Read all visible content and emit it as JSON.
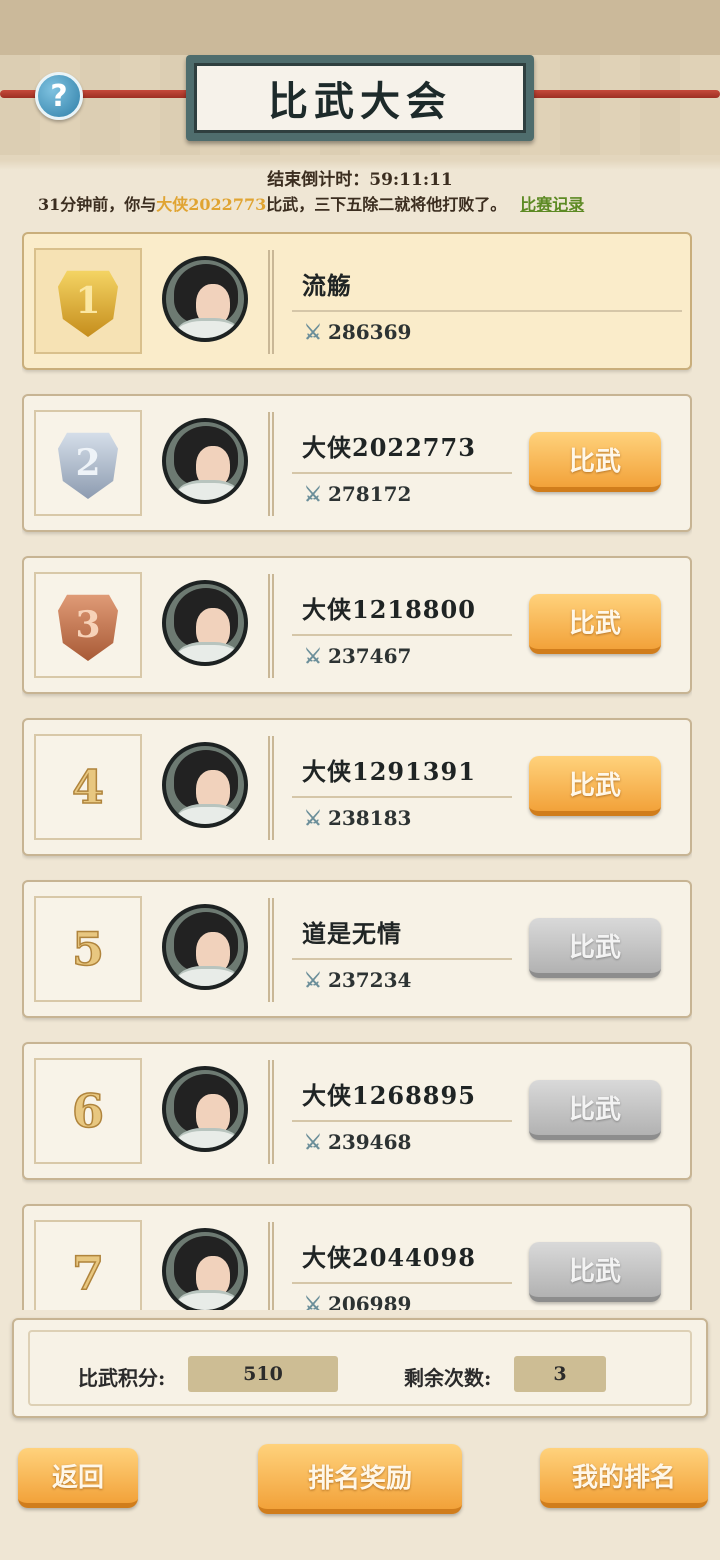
{
  "header": {
    "title": "比武大会",
    "help_icon": "question-icon"
  },
  "countdown": "结束倒计时：59:11:11",
  "news": {
    "before": "31分钟前，你与",
    "opponent": "大侠2022773",
    "after": "比武，三下五除二就将他打败了。",
    "record_link": "比赛记录"
  },
  "colors": {
    "accent_orange": "#f2a23a",
    "highlight_name": "#e0a432",
    "link_green": "#5d8a24",
    "disabled_gray": "#b2b2b2"
  },
  "rankings": [
    {
      "rank": "1",
      "medal": "gold",
      "name": "流觞",
      "power": "286369",
      "button": null
    },
    {
      "rank": "2",
      "medal": "silver",
      "name": "大侠2022773",
      "power": "278172",
      "button": "比武",
      "enabled": true
    },
    {
      "rank": "3",
      "medal": "bronze",
      "name": "大侠1218800",
      "power": "237467",
      "button": "比武",
      "enabled": true
    },
    {
      "rank": "4",
      "medal": null,
      "name": "大侠1291391",
      "power": "238183",
      "button": "比武",
      "enabled": true
    },
    {
      "rank": "5",
      "medal": null,
      "name": "道是无情",
      "power": "237234",
      "button": "比武",
      "enabled": false
    },
    {
      "rank": "6",
      "medal": null,
      "name": "大侠1268895",
      "power": "239468",
      "button": "比武",
      "enabled": false
    },
    {
      "rank": "7",
      "medal": null,
      "name": "大侠2044098",
      "power": "206989",
      "button": "比武",
      "enabled": false
    }
  ],
  "status": {
    "score_label": "比武积分:",
    "score_value": "510",
    "remaining_label": "剩余次数:",
    "remaining_value": "3"
  },
  "footer": {
    "back": "返回",
    "rewards": "排名奖励",
    "my_rank": "我的排名"
  }
}
